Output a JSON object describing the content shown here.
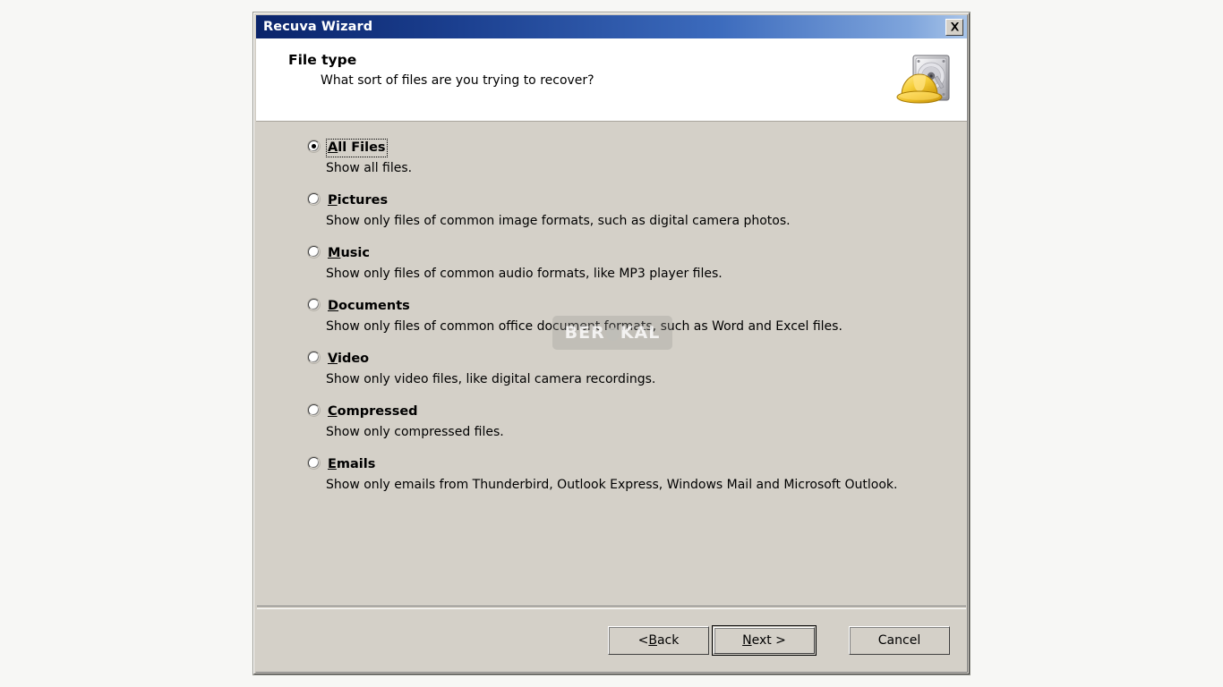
{
  "window": {
    "title": "Recuva Wizard",
    "close_label": "x",
    "close_icon": "close-icon"
  },
  "header": {
    "title": "File type",
    "subtitle": "What sort of files are you trying to recover?",
    "logo_icon": "recuva-harddrive-hardhat-icon"
  },
  "options": [
    {
      "accel": "A",
      "label_rest": "ll Files",
      "description": "Show all files.",
      "selected": true
    },
    {
      "accel": "P",
      "label_rest": "ictures",
      "description": "Show only files of common image formats, such as digital camera photos.",
      "selected": false
    },
    {
      "accel": "M",
      "label_rest": "usic",
      "description": "Show only files of common audio formats, like MP3 player files.",
      "selected": false
    },
    {
      "accel": "D",
      "label_rest": "ocuments",
      "description": "Show only files of common office document formats, such as Word and Excel files.",
      "selected": false
    },
    {
      "accel": "V",
      "label_rest": "ideo",
      "description": "Show only video files, like digital camera recordings.",
      "selected": false
    },
    {
      "accel": "C",
      "label_rest": "ompressed",
      "description": "Show only compressed files.",
      "selected": false
    },
    {
      "accel": "E",
      "label_rest": "mails",
      "description": "Show only emails from Thunderbird, Outlook Express, Windows Mail and Microsoft Outlook.",
      "selected": false
    }
  ],
  "watermark": {
    "text_before": "BER",
    "text_after": "KAL"
  },
  "footer": {
    "back": {
      "prefix": "< ",
      "accel": "B",
      "suffix": "ack"
    },
    "next": {
      "prefix": "",
      "accel": "N",
      "suffix": "ext >"
    },
    "cancel": {
      "prefix": "",
      "accel": "",
      "suffix": "Cancel"
    }
  },
  "colors": {
    "dialog_face": "#d4d0c8",
    "titlebar_start": "#0a246a",
    "titlebar_end": "#a8c4e8",
    "header_band": "#ffffff",
    "text": "#000000"
  }
}
